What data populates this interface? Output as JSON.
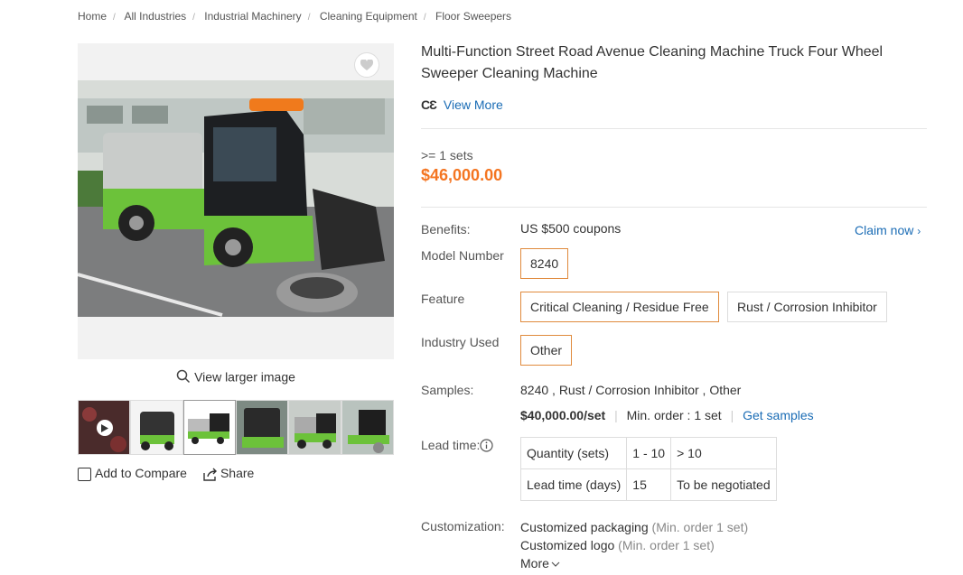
{
  "breadcrumb": [
    "Home",
    "All Industries",
    "Industrial Machinery",
    "Cleaning Equipment",
    "Floor Sweepers"
  ],
  "gallery": {
    "view_larger": "View larger image",
    "thumbs": [
      "video",
      "front",
      "side",
      "rear",
      "right",
      "cab"
    ]
  },
  "actions": {
    "compare": "Add to Compare",
    "share": "Share"
  },
  "product": {
    "title": "Multi-Function Street Road Avenue Cleaning Machine Truck Four Wheel Sweeper Cleaning Machine",
    "cert_mark": "CƐ",
    "view_more": "View More",
    "moq": ">= 1 sets",
    "price": "$46,000.00"
  },
  "benefits": {
    "label": "Benefits:",
    "value": "US $500 coupons",
    "claim": "Claim now"
  },
  "model": {
    "label": "Model Number",
    "options": [
      "8240"
    ]
  },
  "feature": {
    "label": "Feature",
    "options": [
      "Critical Cleaning / Residue Free",
      "Rust / Corrosion Inhibitor"
    ]
  },
  "industry": {
    "label": "Industry Used",
    "options": [
      "Other"
    ]
  },
  "samples": {
    "label": "Samples:",
    "summary": "8240 , Rust / Corrosion Inhibitor , Other",
    "price": "$40,000.00/set",
    "min_order": "Min. order : 1 set",
    "get": "Get samples"
  },
  "lead_time": {
    "label": "Lead time:",
    "rows": [
      [
        "Quantity (sets)",
        "1 - 10",
        "> 10"
      ],
      [
        "Lead time (days)",
        "15",
        "To be negotiated"
      ]
    ]
  },
  "customization": {
    "label": "Customization:",
    "items": [
      {
        "name": "Customized packaging",
        "note": "(Min. order 1 set)"
      },
      {
        "name": "Customized logo",
        "note": "(Min. order 1 set)"
      }
    ],
    "more": "More"
  },
  "colors": {
    "accent": "#f47521",
    "link": "#1a6cb5",
    "selected_border": "#e08a3c",
    "truck_green": "#6cc23a"
  }
}
